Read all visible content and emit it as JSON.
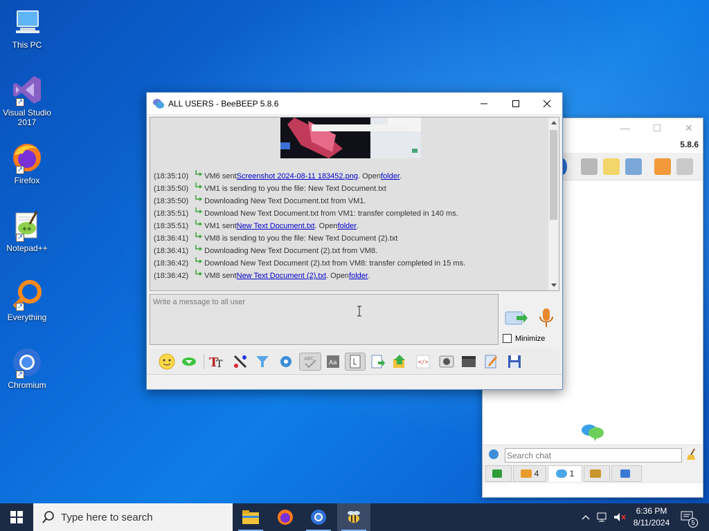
{
  "desktop": {
    "icons": [
      {
        "label": "This PC"
      },
      {
        "label": "Visual Studio 2017"
      },
      {
        "label": "Firefox"
      },
      {
        "label": "Notepad++"
      },
      {
        "label": "Everything"
      },
      {
        "label": "Chromium"
      }
    ]
  },
  "main_window": {
    "title": "ALL USERS - BeeBEEP 5.8.6",
    "log": [
      {
        "time": "(18:35:10)",
        "pre": "VM6 sent ",
        "link": "Screenshot 2024-08-11 183452.png",
        "mid": ". Open ",
        "link2": "folder",
        "post": "."
      },
      {
        "time": "(18:35:50)",
        "pre": "VM1 is sending to you the file: New Text Document.txt",
        "link": "",
        "mid": "",
        "link2": "",
        "post": ""
      },
      {
        "time": "(18:35:50)",
        "pre": "Downloading New Text Document.txt from VM1.",
        "link": "",
        "mid": "",
        "link2": "",
        "post": ""
      },
      {
        "time": "(18:35:51)",
        "pre": "Download New Text Document.txt from VM1: transfer completed in 140 ms.",
        "link": "",
        "mid": "",
        "link2": "",
        "post": ""
      },
      {
        "time": "(18:35:51)",
        "pre": "VM1 sent ",
        "link": "New Text Document.txt",
        "mid": ". Open ",
        "link2": "folder",
        "post": "."
      },
      {
        "time": "(18:36:41)",
        "pre": "VM8 is sending to you the file: New Text Document (2).txt",
        "link": "",
        "mid": "",
        "link2": "",
        "post": ""
      },
      {
        "time": "(18:36:41)",
        "pre": "Downloading New Text Document (2).txt from VM8.",
        "link": "",
        "mid": "",
        "link2": "",
        "post": ""
      },
      {
        "time": "(18:36:42)",
        "pre": "Download New Text Document (2).txt from VM8: transfer completed in 15 ms.",
        "link": "",
        "mid": "",
        "link2": "",
        "post": ""
      },
      {
        "time": "(18:36:42)",
        "pre": "VM8 sent ",
        "link": "New Text Document (2).txt",
        "mid": ". Open ",
        "link2": "folder",
        "post": "."
      }
    ],
    "message_placeholder": "Write a message to all user",
    "minimize_label": "Minimize"
  },
  "back_window": {
    "version": "5.8.6",
    "search_placeholder": "Search chat",
    "tabs": [
      {
        "count": ""
      },
      {
        "count": "4"
      },
      {
        "count": "1"
      },
      {
        "count": ""
      },
      {
        "count": ""
      }
    ]
  },
  "taskbar": {
    "search_placeholder": "Type here to search",
    "time": "6:36 PM",
    "date": "8/11/2024",
    "notification_count": "5"
  },
  "colors": {
    "link": "#0000cc",
    "taskbar": "#1b2a45",
    "desktop": "#0b66d4"
  }
}
